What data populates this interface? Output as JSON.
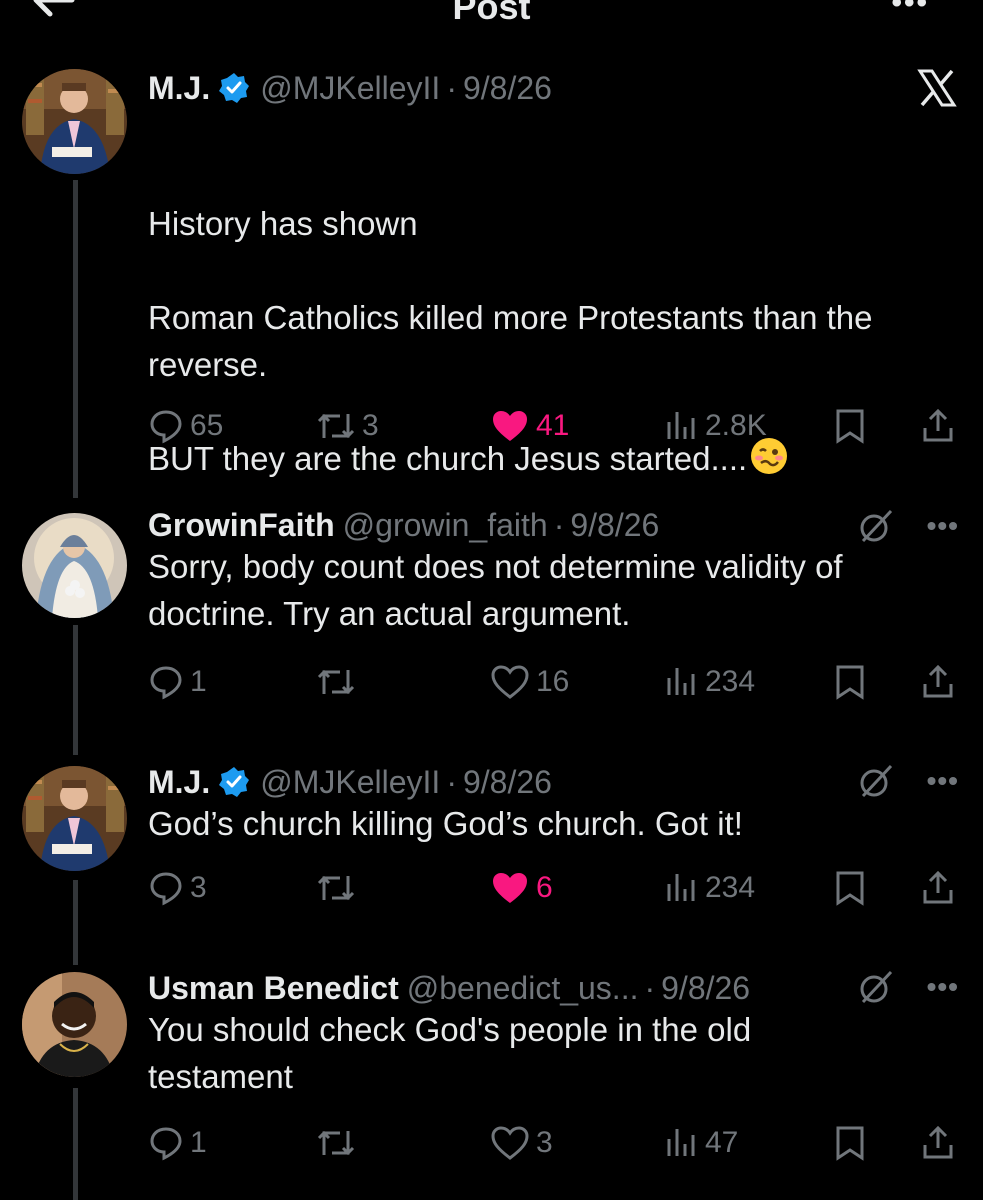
{
  "app": {
    "title": "Post"
  },
  "posts": [
    {
      "name": "M.J.",
      "verified": true,
      "handle": "@MJKelleyII",
      "separator": "·",
      "date": "9/8/26",
      "text_lines": [
        "History has shown",
        "",
        "Roman Catholics killed more Protestants than the",
        "reverse.",
        "",
        "BUT they are the church Jesus started...."
      ],
      "emoji": "woozy-face-emoji",
      "replies": "65",
      "reposts": "3",
      "likes": "41",
      "liked": true,
      "views": "2.8K",
      "top_right": "x-logo-icon"
    },
    {
      "name": "GrowinFaith",
      "verified": false,
      "handle": "@growin_faith",
      "separator": "·",
      "date": "9/8/26",
      "text_lines": [
        "Sorry, body count does not determine validity of",
        "doctrine. Try an actual argument."
      ],
      "replies": "1",
      "reposts": "",
      "likes": "16",
      "liked": false,
      "views": "234"
    },
    {
      "name": "M.J.",
      "verified": true,
      "handle": "@MJKelleyII",
      "separator": "·",
      "date": "9/8/26",
      "text_lines": [
        "God’s church killing God’s church. Got it!"
      ],
      "replies": "3",
      "reposts": "",
      "likes": "6",
      "liked": true,
      "views": "234"
    },
    {
      "name": "Usman Benedict",
      "verified": false,
      "handle": "@benedict_us...",
      "separator": "·",
      "date": "9/8/26",
      "text_lines": [
        "You should check God's people in the old",
        "testament"
      ],
      "replies": "1",
      "reposts": "",
      "likes": "3",
      "liked": false,
      "views": "47"
    }
  ],
  "colors": {
    "background": "#000000",
    "text": "#e7e9ea",
    "muted": "#71767b",
    "like": "#f91880",
    "verified": "#1d9bf0",
    "thread_line": "#333639"
  },
  "icons": [
    "back-arrow-icon",
    "more-icon",
    "reply-icon",
    "repost-icon",
    "like-icon",
    "views-icon",
    "bookmark-icon",
    "share-icon",
    "grok-icon",
    "verified-icon"
  ]
}
